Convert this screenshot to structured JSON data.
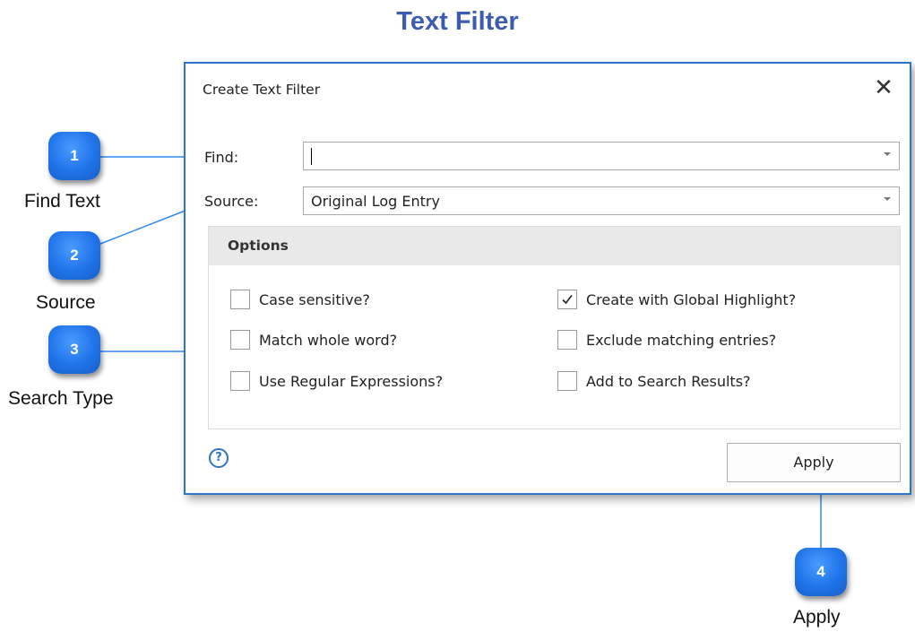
{
  "page": {
    "title": "Text Filter"
  },
  "dialog": {
    "title": "Create Text Filter",
    "close_symbol": "✕",
    "find": {
      "label": "Find:",
      "value": ""
    },
    "source": {
      "label": "Source:",
      "value": "Original Log Entry"
    },
    "options": {
      "header": "Options",
      "items": [
        {
          "label": "Case sensitive?",
          "checked": false
        },
        {
          "label": "Match whole word?",
          "checked": false
        },
        {
          "label": "Use Regular Expressions?",
          "checked": false
        },
        {
          "label": "Create with Global Highlight?",
          "checked": true
        },
        {
          "label": "Exclude matching entries?",
          "checked": false
        },
        {
          "label": "Add to Search Results?",
          "checked": false
        }
      ]
    },
    "help_symbol": "?",
    "apply_label": "Apply"
  },
  "callouts": [
    {
      "number": "1",
      "caption": "Find Text"
    },
    {
      "number": "2",
      "caption": "Source"
    },
    {
      "number": "3",
      "caption": "Search Type"
    },
    {
      "number": "4",
      "caption": "Apply"
    }
  ],
  "colors": {
    "title": "#3c5cb0",
    "dialog_border": "#2f74c6",
    "callout": "#1f73e8",
    "callout_line": "#2f8af0"
  },
  "icons": {
    "close": "close-icon",
    "help": "help-icon",
    "dropdown": "chevron-down-icon",
    "checkmark": "checkmark-icon"
  }
}
